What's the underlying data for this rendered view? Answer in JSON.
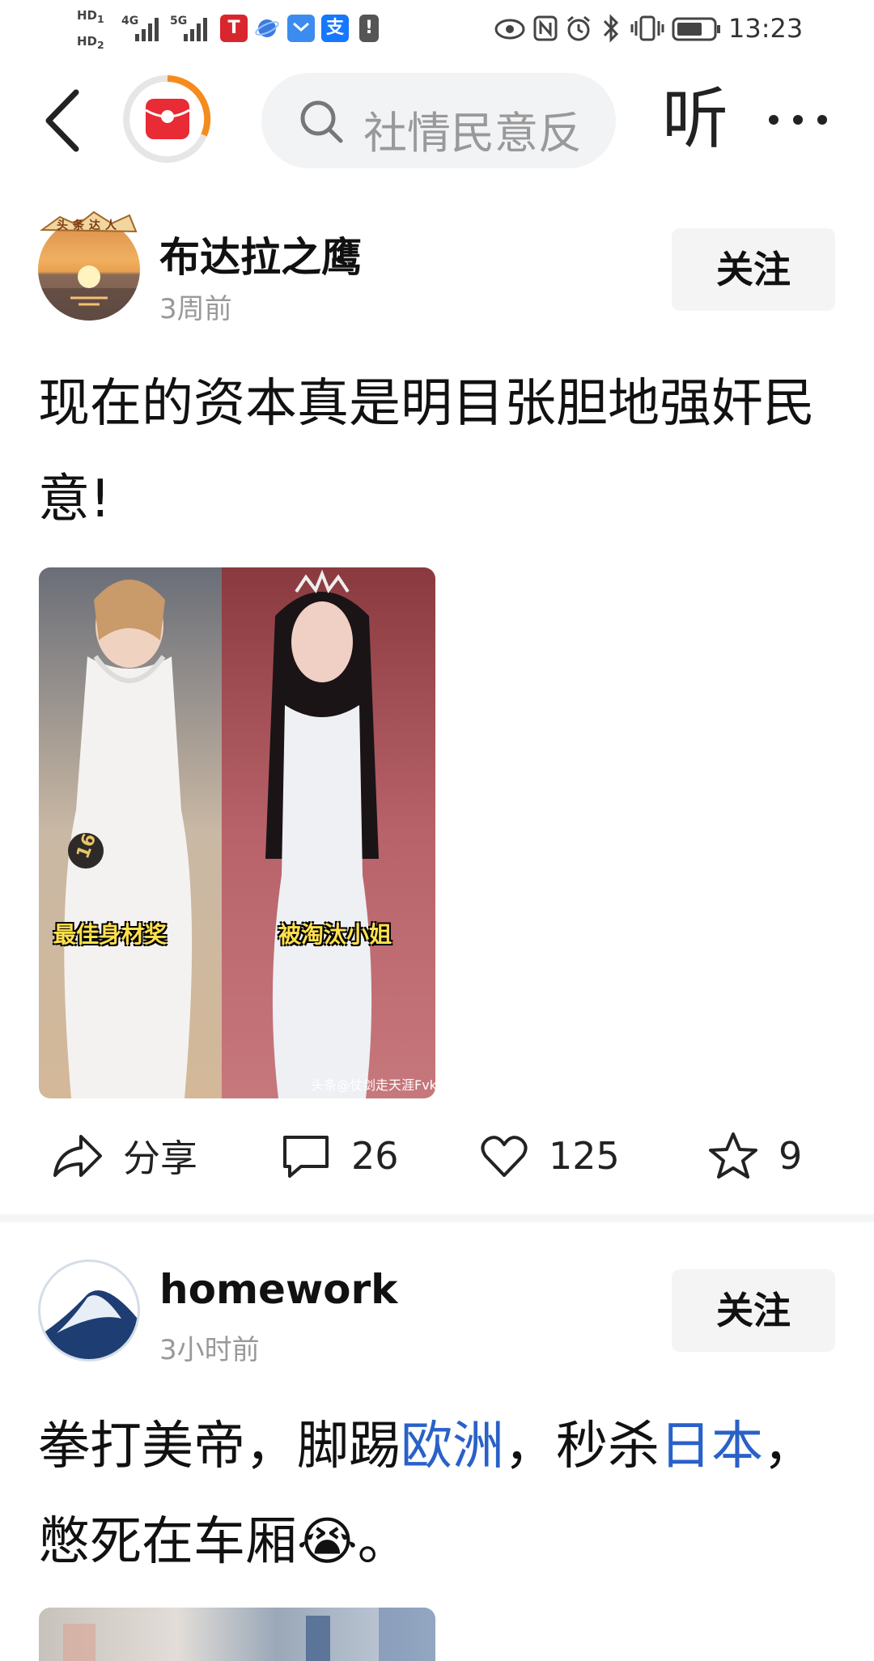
{
  "status_bar": {
    "hd1": "HD",
    "hd1_sub": "1",
    "hd2": "HD",
    "hd2_sub": "2",
    "net1": "4G",
    "net2": "5G",
    "alipay": "支",
    "time": "13:23"
  },
  "header": {
    "search_placeholder": "社情民意反",
    "listen_label": "听",
    "more_label": "···"
  },
  "posts": [
    {
      "author": "布达拉之鹰",
      "avatar_badge": "头条达人",
      "time": "3周前",
      "follow_label": "关注",
      "text": "现在的资本真是明目张胆地强奸民意!",
      "image": {
        "left_caption": "最佳身材奖",
        "right_caption": "被淘汰小姐",
        "number_badge": "16",
        "watermark": "头条@仗剑走天涯FvkV"
      },
      "actions": {
        "share_label": "分享",
        "comments": "26",
        "likes": "125",
        "favorites": "9"
      }
    },
    {
      "author": "homework",
      "time": "3小时前",
      "follow_label": "关注",
      "text_parts": [
        "拳打美帝，脚踢",
        "欧洲",
        "，秒杀",
        "日本",
        "，憋死在车厢",
        "😭",
        "。"
      ]
    }
  ],
  "colors": {
    "link": "#2a61c8",
    "follow_bg": "#f4f4f4",
    "search_bg": "#f2f3f5",
    "secondary_text": "#999999"
  }
}
